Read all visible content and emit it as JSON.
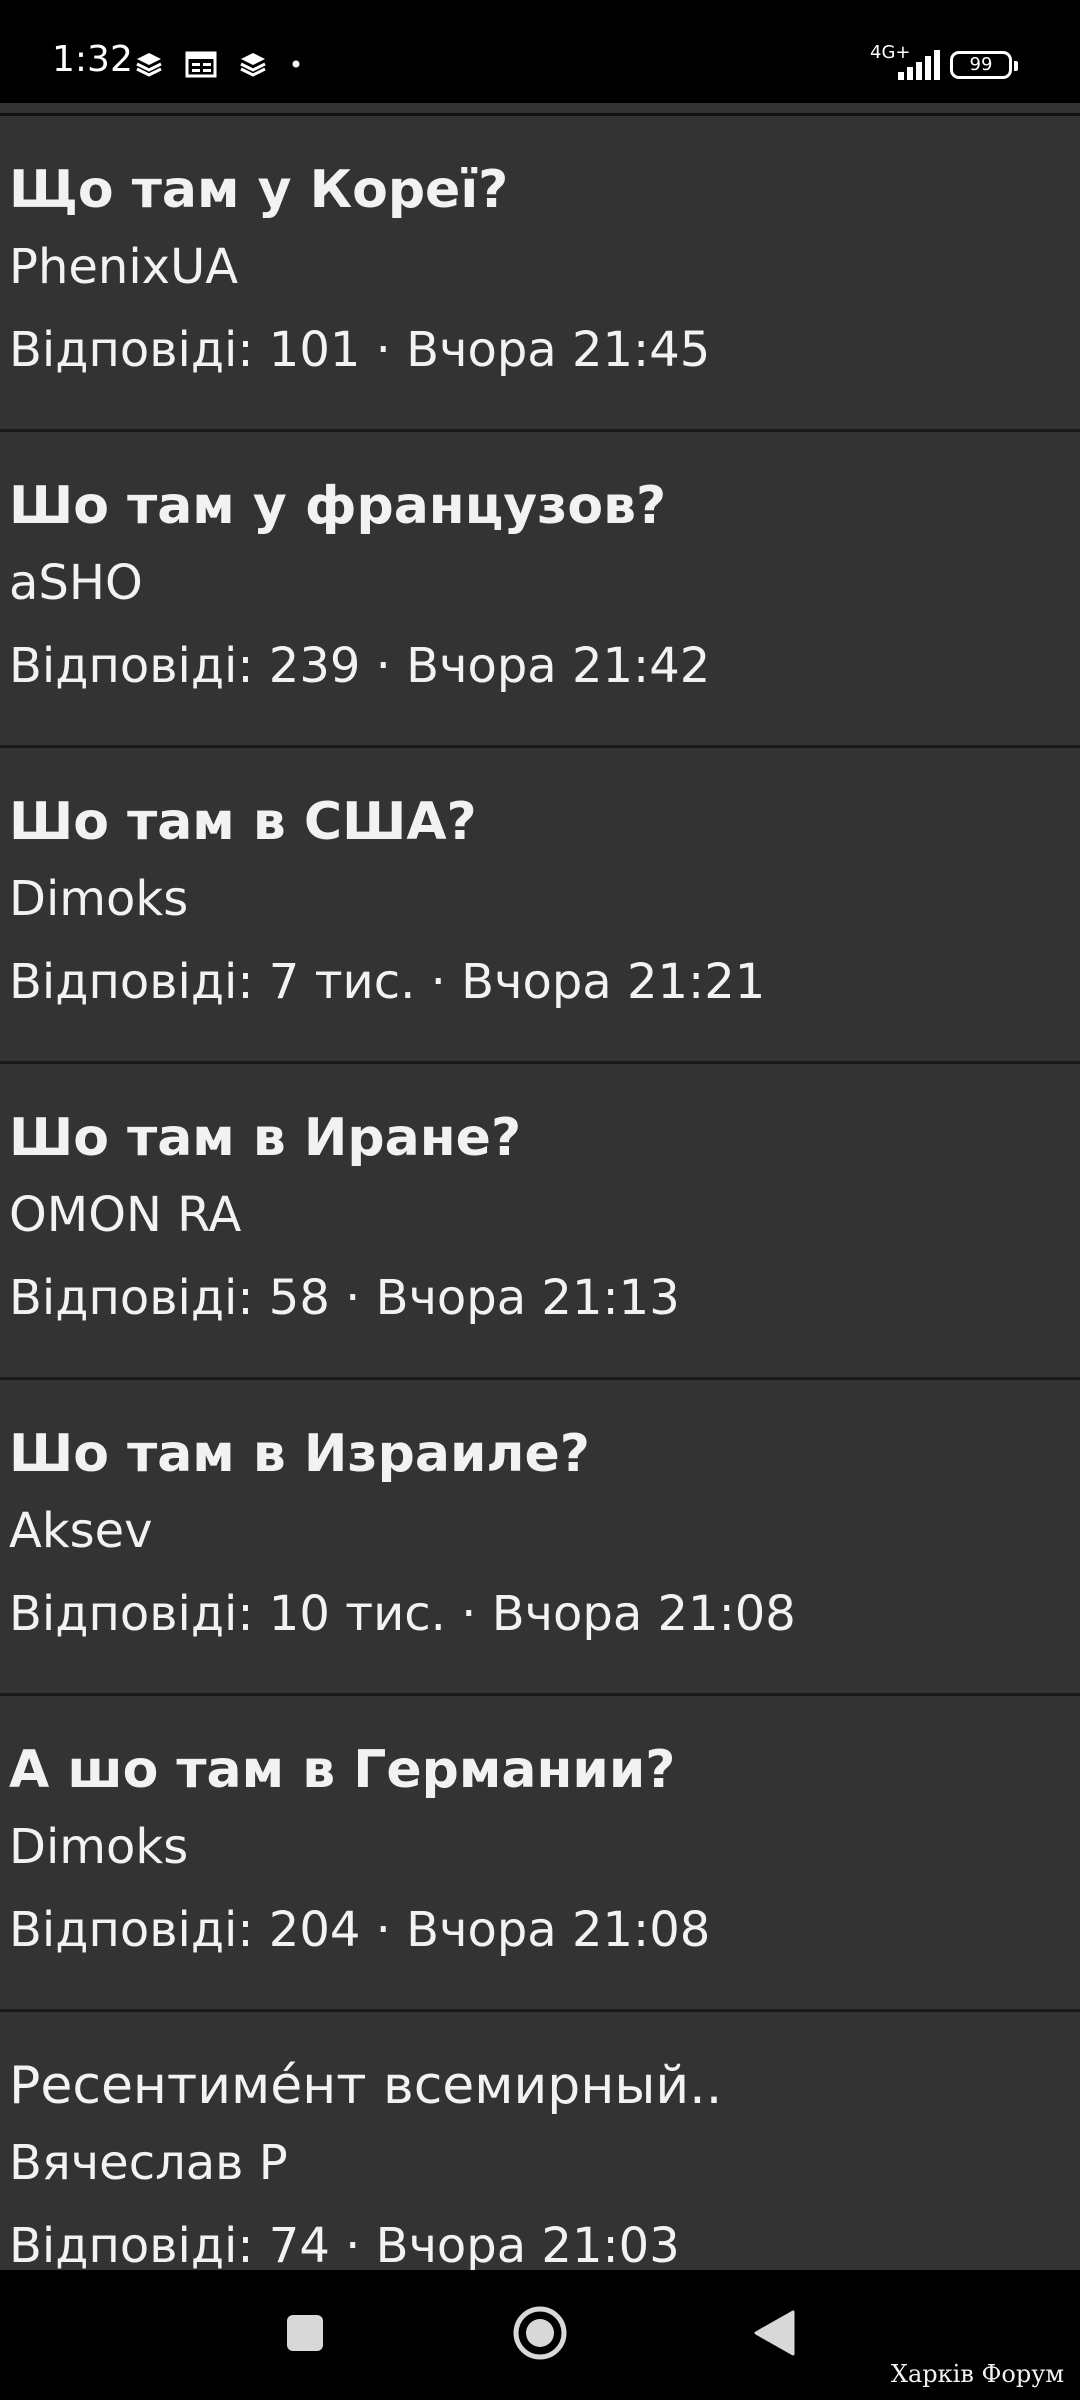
{
  "status_bar": {
    "time": "1:32",
    "network": "4G+",
    "battery": "99",
    "icons": [
      "layers-icon",
      "calendar-icon",
      "layers-icon",
      "dot-icon",
      "signal-icon",
      "battery-icon"
    ]
  },
  "topics": [
    {
      "title": "Що там у Кореї?",
      "author": "PhenixUA",
      "meta": "Відповіді: 101 · Вчора 21:45",
      "bold": true
    },
    {
      "title": "Шо там у французов?",
      "author": "aSHO",
      "meta": "Відповіді: 239 · Вчора 21:42",
      "bold": true
    },
    {
      "title": "Шо там в США?",
      "author": "Dimoks",
      "meta": "Відповіді: 7 тис. · Вчора 21:21",
      "bold": true
    },
    {
      "title": "Шо там в Иране?",
      "author": "OMON RA",
      "meta": "Відповіді: 58 · Вчора 21:13",
      "bold": true
    },
    {
      "title": "Шо там в Израиле?",
      "author": "Aksev",
      "meta": "Відповіді: 10 тис. · Вчора 21:08",
      "bold": true
    },
    {
      "title": "А шо там в Германии?",
      "author": "Dimoks",
      "meta": "Відповіді: 204 · Вчора 21:08",
      "bold": true
    },
    {
      "title": "Ресентиме́нт всемирный..",
      "author": "Вячеслав Р",
      "meta": "Відповіді: 74 · Вчора 21:03",
      "bold": false
    }
  ],
  "nav_bar": {
    "icons": [
      "recents-icon",
      "home-icon",
      "back-icon"
    ]
  },
  "watermark": "Харків Форум",
  "colors": {
    "background": "#333333",
    "text": "#f2f2f2",
    "bars": "#000000"
  }
}
